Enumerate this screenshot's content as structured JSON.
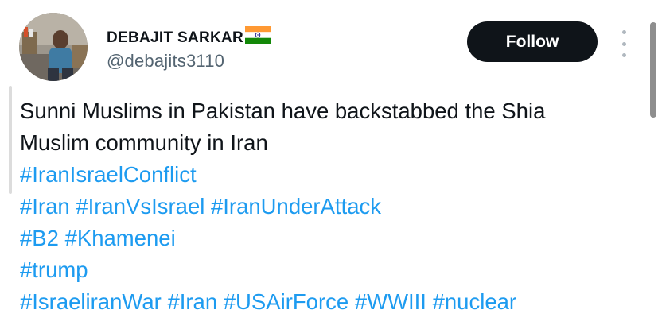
{
  "author": {
    "display_name": "DEBAJIT SARKAR",
    "handle": "@debajits3110",
    "flag_icon": "india-flag-icon",
    "avatar_icon": "profile-photo"
  },
  "actions": {
    "follow_label": "Follow",
    "more_icon": "more-options-icon"
  },
  "tweet": {
    "text_lines": [
      "Sunni Muslims in Pakistan have backstabbed the Shia",
      "Muslim community in Iran"
    ],
    "hashtag_lines": [
      [
        "#IranIsraelConflict"
      ],
      [
        "#Iran",
        "#IranVsIsrael",
        "#IranUnderAttack"
      ],
      [
        "#B2",
        "#Khamenei"
      ],
      [
        "#trump"
      ],
      [
        "#IsraeliranWar",
        "#Iran",
        "#USAirForce",
        "#WWIII",
        "#nuclear"
      ]
    ]
  },
  "colors": {
    "link": "#1d9bf0",
    "text": "#0f1419",
    "secondary": "#536471",
    "button_bg": "#0f1419",
    "button_text": "#ffffff"
  }
}
